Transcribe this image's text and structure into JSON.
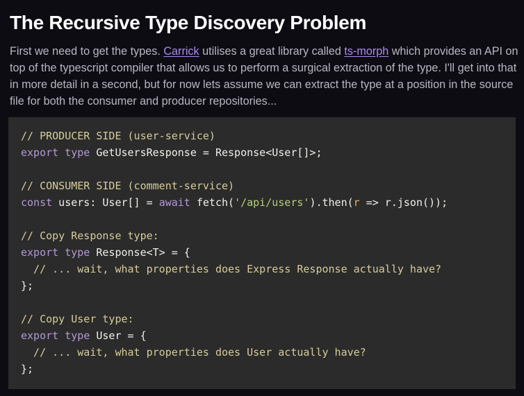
{
  "heading": "The Recursive Type Discovery Problem",
  "paragraph": {
    "part1": "First we need to get the types. ",
    "link1": "Carrick",
    "part2": " utilises a great library called ",
    "link2": "ts-morph",
    "part3": " which provides an API on top of the typescript compiler that allows us to perform a surgical extraction of the type. I'll get into that in more detail in a second, but for now lets assume we can extract the type at a position in the source file for both the consumer and producer repositories..."
  },
  "code": {
    "l1": "// PRODUCER SIDE (user-service)",
    "l2_kw1": "export",
    "l2_kw2": "type",
    "l2_rest": " GetUsersResponse = Response<User[]>;",
    "l4": "// CONSUMER SIDE (comment-service)",
    "l5_kw1": "const",
    "l5_a": " users: User[] = ",
    "l5_kw2": "await",
    "l5_b": " fetch(",
    "l5_str": "'/api/users'",
    "l5_c": ").then(",
    "l5_param": "r",
    "l5_d": " => r.json());",
    "l7": "// Copy Response type:",
    "l8_kw1": "export",
    "l8_kw2": "type",
    "l8_rest": " Response<T> = {",
    "l9": "  // ... wait, what properties does Express Response actually have?",
    "l10": "};",
    "l12": "// Copy User type:",
    "l13_kw1": "export",
    "l13_kw2": "type",
    "l13_rest": " User = {",
    "l14": "  // ... wait, what properties does User actually have?",
    "l15": "};"
  },
  "colors": {
    "background": "#0e0c13",
    "code_background": "#2b2b2b",
    "link": "#a98cf0",
    "comment": "#d6cc9a",
    "keyword": "#b39ad6",
    "string": "#b4cf7c",
    "parameter": "#e8b25a"
  }
}
